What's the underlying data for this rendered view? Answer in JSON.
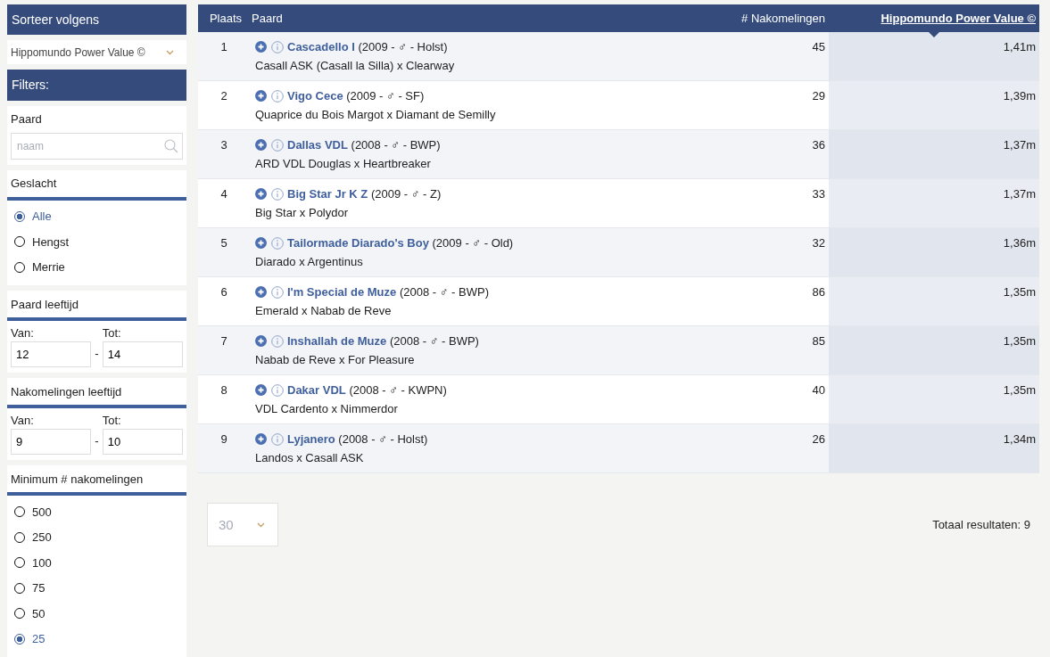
{
  "sort": {
    "title": "Sorteer volgens",
    "value": "Hippomundo Power Value ©"
  },
  "filters_title": "Filters:",
  "filters": [
    {
      "kind": "search",
      "label": "Paard",
      "placeholder": "naam"
    },
    {
      "kind": "radio",
      "label": "Geslacht",
      "options": [
        {
          "label": "Alle",
          "selected": true
        },
        {
          "label": "Hengst",
          "selected": false
        },
        {
          "label": "Merrie",
          "selected": false
        }
      ]
    },
    {
      "kind": "range",
      "label": "Paard leeftijd",
      "from_label": "Van:",
      "from": "12",
      "separator": "-",
      "to_label": "Tot:",
      "to": "14"
    },
    {
      "kind": "range",
      "label": "Nakomelingen leeftijd",
      "from_label": "Van:",
      "from": "9",
      "separator": "-",
      "to_label": "Tot:",
      "to": "10"
    },
    {
      "kind": "radio",
      "label": "Minimum # nakomelingen",
      "options": [
        {
          "label": "500",
          "selected": false
        },
        {
          "label": "250",
          "selected": false
        },
        {
          "label": "100",
          "selected": false
        },
        {
          "label": "75",
          "selected": false
        },
        {
          "label": "50",
          "selected": false
        },
        {
          "label": "25",
          "selected": true
        }
      ]
    }
  ],
  "table": {
    "columns": [
      {
        "label": "Plaats",
        "sorted": false
      },
      {
        "label": "Paard",
        "sorted": false
      },
      {
        "label": "# Nakomelingen",
        "sorted": false
      },
      {
        "label": "Hippomundo Power Value ©",
        "sorted": true
      }
    ],
    "rows": [
      {
        "rank": "1",
        "name": "Cascadello I",
        "details": "(2009 - ♂ - Holst)",
        "pedigree": "Casall ASK (Casall la Silla) x Clearway",
        "offspring": "45",
        "value": "1,41m"
      },
      {
        "rank": "2",
        "name": "Vigo Cece",
        "details": "(2009 - ♂ - SF)",
        "pedigree": "Quaprice du Bois Margot x Diamant de Semilly",
        "offspring": "29",
        "value": "1,39m"
      },
      {
        "rank": "3",
        "name": "Dallas VDL",
        "details": "(2008 - ♂ - BWP)",
        "pedigree": "ARD VDL Douglas x Heartbreaker",
        "offspring": "36",
        "value": "1,37m"
      },
      {
        "rank": "4",
        "name": "Big Star Jr K Z",
        "details": "(2009 - ♂ - Z)",
        "pedigree": "Big Star x Polydor",
        "offspring": "33",
        "value": "1,37m"
      },
      {
        "rank": "5",
        "name": "Tailormade Diarado's Boy",
        "details": "(2009 - ♂ - Old)",
        "pedigree": "Diarado x Argentinus",
        "offspring": "32",
        "value": "1,36m"
      },
      {
        "rank": "6",
        "name": "I'm Special de Muze",
        "details": "(2008 - ♂ - BWP)",
        "pedigree": "Emerald x Nabab de Reve",
        "offspring": "86",
        "value": "1,35m"
      },
      {
        "rank": "7",
        "name": "Inshallah de Muze",
        "details": "(2008 - ♂ - BWP)",
        "pedigree": "Nabab de Reve x For Pleasure",
        "offspring": "85",
        "value": "1,35m"
      },
      {
        "rank": "8",
        "name": "Dakar VDL",
        "details": "(2008 - ♂ - KWPN)",
        "pedigree": "VDL Cardento x Nimmerdor",
        "offspring": "40",
        "value": "1,35m"
      },
      {
        "rank": "9",
        "name": "Lyjanero",
        "details": "(2008 - ♂ - Holst)",
        "pedigree": "Landos x Casall ASK",
        "offspring": "26",
        "value": "1,34m"
      }
    ]
  },
  "pager": {
    "per_page": "30",
    "total": "Totaal resultaten: 9"
  }
}
